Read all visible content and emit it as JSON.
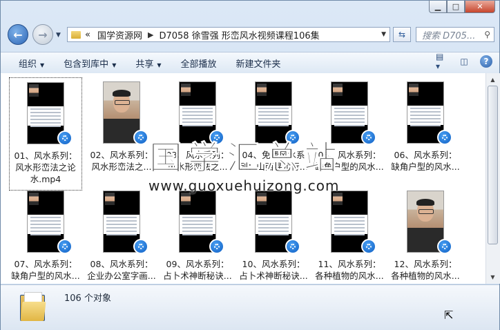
{
  "window": {
    "caption_buttons": [
      "minimize",
      "maximize",
      "close"
    ]
  },
  "nav": {
    "breadcrumb": [
      "国学资源网",
      "D7058 徐雪强 形峦风水视频课程106集"
    ],
    "breadcrumb_prefix": "«",
    "search_placeholder": "搜索 D705...",
    "refresh_icon": "refresh-icon"
  },
  "toolbar": {
    "organize": "组织",
    "include_library": "包含到库中",
    "share": "共享",
    "play_all": "全部播放",
    "new_folder": "新建文件夹"
  },
  "files": [
    {
      "line1": "01、风水系列：",
      "line2": "风水形峦法之论",
      "line3": "水.mp4",
      "thumb": "doc",
      "selected": true
    },
    {
      "line1": "02、风水系列：",
      "line2": "风水形峦法之...",
      "thumb": "portrait"
    },
    {
      "line1": "03、风水系列：",
      "line2": "风水形峦法之...",
      "thumb": "doc"
    },
    {
      "line1": "04、免费风水系",
      "line2": "列：山西寻龙行...",
      "thumb": "doc"
    },
    {
      "line1": "05、风水系列：",
      "line2": "缺角户型的风水...",
      "thumb": "doc"
    },
    {
      "line1": "06、风水系列：",
      "line2": "缺角户型的风水...",
      "thumb": "doc"
    },
    {
      "line1": "07、风水系列：",
      "line2": "缺角户型的风水...",
      "thumb": "doc"
    },
    {
      "line1": "08、风水系列：",
      "line2": "企业办公室字画...",
      "thumb": "doc"
    },
    {
      "line1": "09、风水系列：",
      "line2": "占卜术神断秘诀...",
      "thumb": "doc"
    },
    {
      "line1": "10、风水系列：",
      "line2": "占卜术神断秘诀...",
      "thumb": "doc"
    },
    {
      "line1": "11、风水系列：",
      "line2": "各种植物的风水...",
      "thumb": "doc"
    },
    {
      "line1": "12、风水系列：",
      "line2": "各种植物的风水...",
      "thumb": "portrait"
    }
  ],
  "watermark": {
    "text": "国学汇总站",
    "url": "www.guoxuehuizong.com"
  },
  "status": {
    "count": "106 个对象"
  }
}
